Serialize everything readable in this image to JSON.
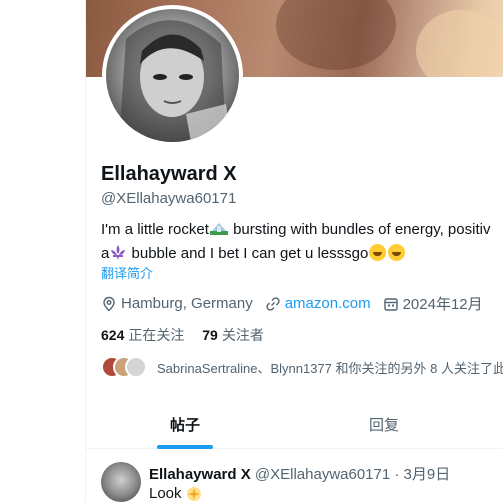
{
  "profile": {
    "display_name": "Ellahayward X",
    "handle": "@XEllahaywa60171",
    "bio_line1_a": "I'm a little rocket",
    "bio_line1_b": " bursting with bundles of energy, positiv",
    "bio_line2_a": "a",
    "bio_line2_b": " bubble and I bet I can get u lesssgo",
    "translate_label": "翻译简介",
    "location": "Hamburg, Germany",
    "website": "amazon.com",
    "joined": "2024年12月"
  },
  "follow": {
    "following_count": "624",
    "following_label": "正在关注",
    "followers_count": "79",
    "followers_label": "关注者"
  },
  "followed_by": {
    "text": "SabrinaSertraline、Blynn1377 和你关注的另外 8 人关注了此"
  },
  "tabs": [
    {
      "label": "帖子",
      "active": true
    },
    {
      "label": "回复",
      "active": false
    }
  ],
  "tweet": {
    "author": "Ellahayward X",
    "meta": "@XEllahaywa60171 · 3月9日",
    "text": "Look"
  },
  "colors": {
    "accent": "#1d9bf0",
    "secondary_text": "#536471",
    "primary_text": "#0f1419"
  }
}
